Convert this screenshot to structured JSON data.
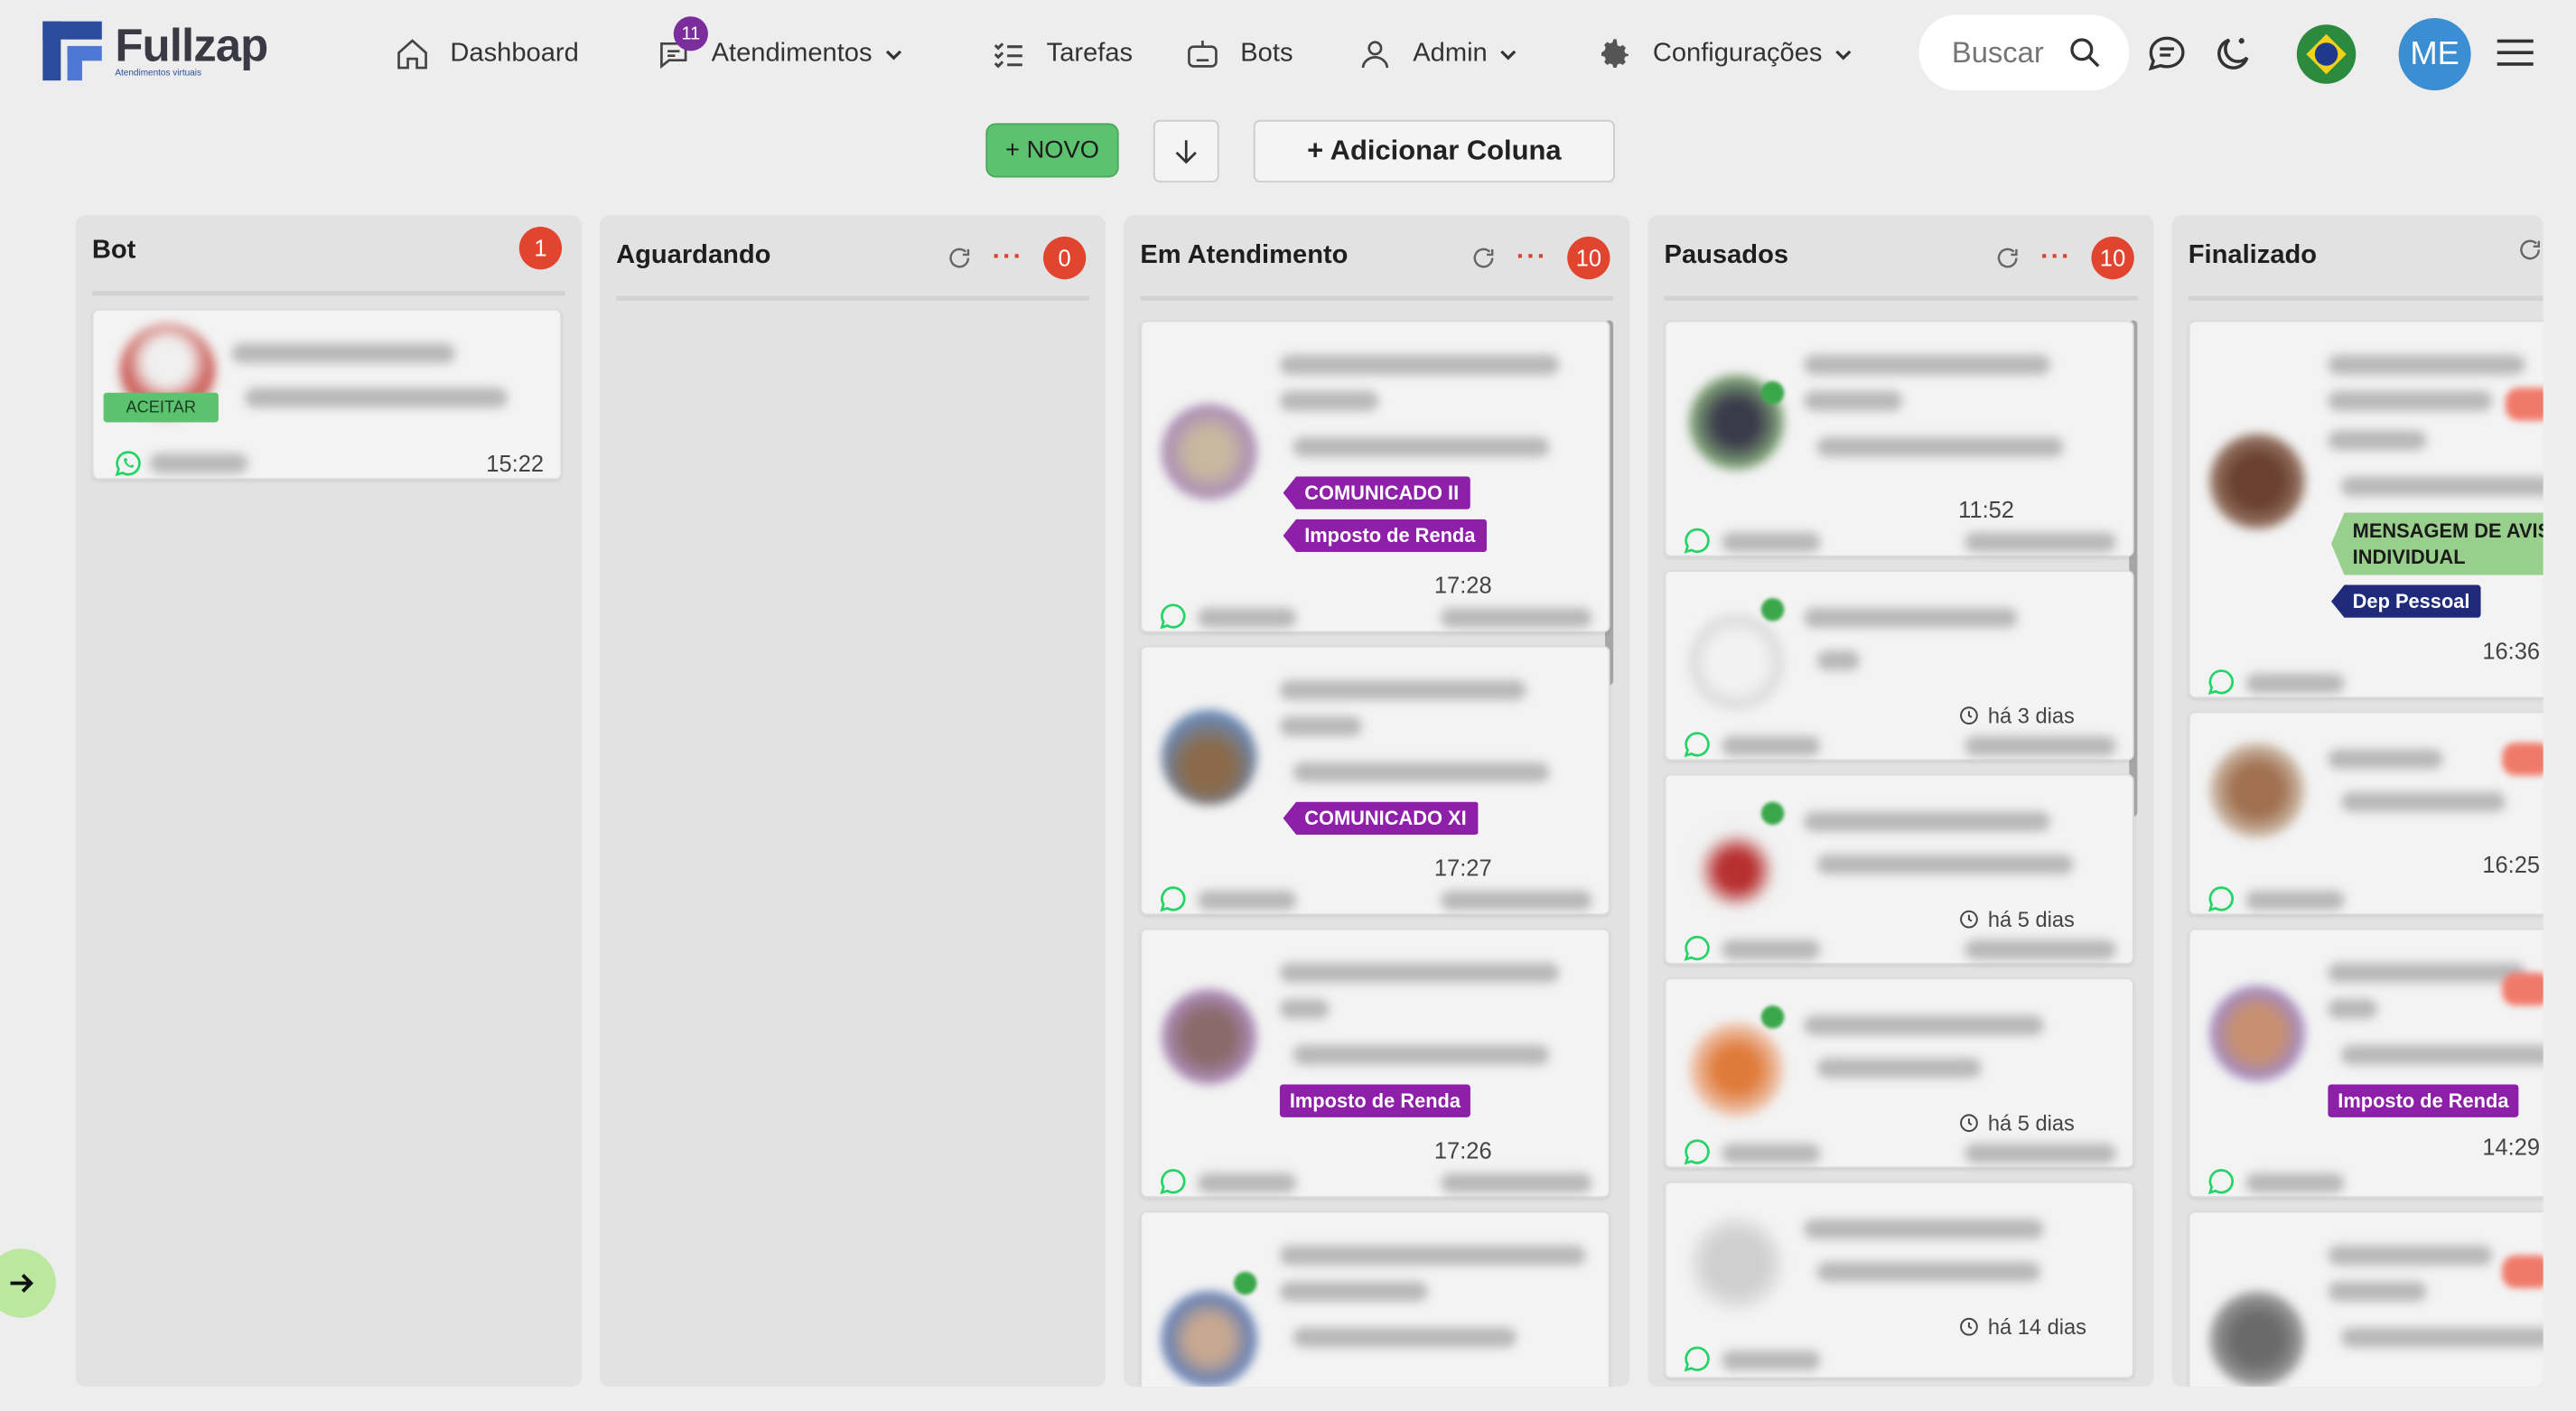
{
  "app": {
    "name": "Fullzap",
    "tagline": "Atendimentos virtuais"
  },
  "nav": {
    "dashboard": "Dashboard",
    "atendimentos": "Atendimentos",
    "atendimentos_badge": "11",
    "tarefas": "Tarefas",
    "bots": "Bots",
    "admin": "Admin",
    "configuracoes": "Configurações",
    "search_placeholder": "Buscar",
    "user_initials": "ME"
  },
  "toolbar": {
    "novo": "+ NOVO",
    "add_column": "+ Adicionar Coluna"
  },
  "columns": [
    {
      "title": "Bot",
      "count": "1",
      "cards": [
        {
          "accept": "ACEITAR",
          "time": "15:22"
        }
      ]
    },
    {
      "title": "Aguardando",
      "count": "0",
      "cards": []
    },
    {
      "title": "Em Atendimento",
      "count": "10",
      "cards": [
        {
          "tags": [
            "COMUNICADO II",
            "Imposto de Renda"
          ],
          "time": "17:28"
        },
        {
          "tags": [
            "COMUNICADO XI"
          ],
          "time": "17:27"
        },
        {
          "tags": [
            "Imposto de Renda"
          ],
          "time": "17:26"
        }
      ]
    },
    {
      "title": "Pausados",
      "count": "10",
      "cards": [
        {
          "time": "11:52"
        },
        {
          "time": "há 3 dias"
        },
        {
          "time": "há 5 dias"
        },
        {
          "time": "há 5 dias"
        },
        {
          "time": "há 14 dias"
        }
      ]
    },
    {
      "title": "Finalizado",
      "cards": [
        {
          "tags": [
            "MENSAGEM DE AVIS",
            "INDIVIDUAL",
            "Dep Pessoal"
          ],
          "time": "16:36"
        },
        {
          "time": "16:25"
        },
        {
          "tags": [
            "Imposto de Renda"
          ],
          "time": "14:29"
        }
      ]
    }
  ],
  "colors": {
    "accent_green": "#5cc26f",
    "badge_red": "#e2452f",
    "tag_purple": "#8e1fa8",
    "tag_navy": "#1f2b7a",
    "tag_green": "#99cf8c",
    "whatsapp": "#25d366"
  }
}
